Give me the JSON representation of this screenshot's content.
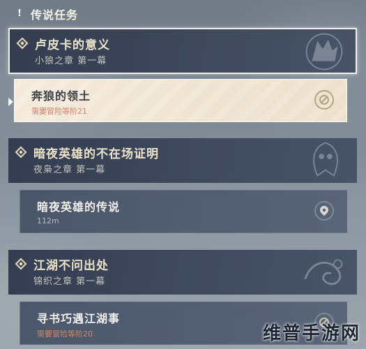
{
  "header": {
    "title": "传说任务"
  },
  "quests": [
    {
      "title": "卢皮卡的意义",
      "subtitle": "小狼之章 第一幕"
    },
    {
      "title": "暗夜英雄的不在场证明",
      "subtitle": "夜枭之章 第一幕"
    },
    {
      "title": "江湖不问出处",
      "subtitle": "锦织之章 第一幕"
    }
  ],
  "subquests": [
    {
      "title": "奔狼的领土",
      "note": "需要冒险等阶21",
      "icon": "locked-icon"
    },
    {
      "title": "暗夜英雄的传说",
      "note": "112m",
      "icon": "location-pin-icon"
    },
    {
      "title": "寻书巧遇江湖事",
      "note": "需要冒险等阶20",
      "icon": "locked-icon"
    }
  ],
  "watermark": "维普手游网"
}
